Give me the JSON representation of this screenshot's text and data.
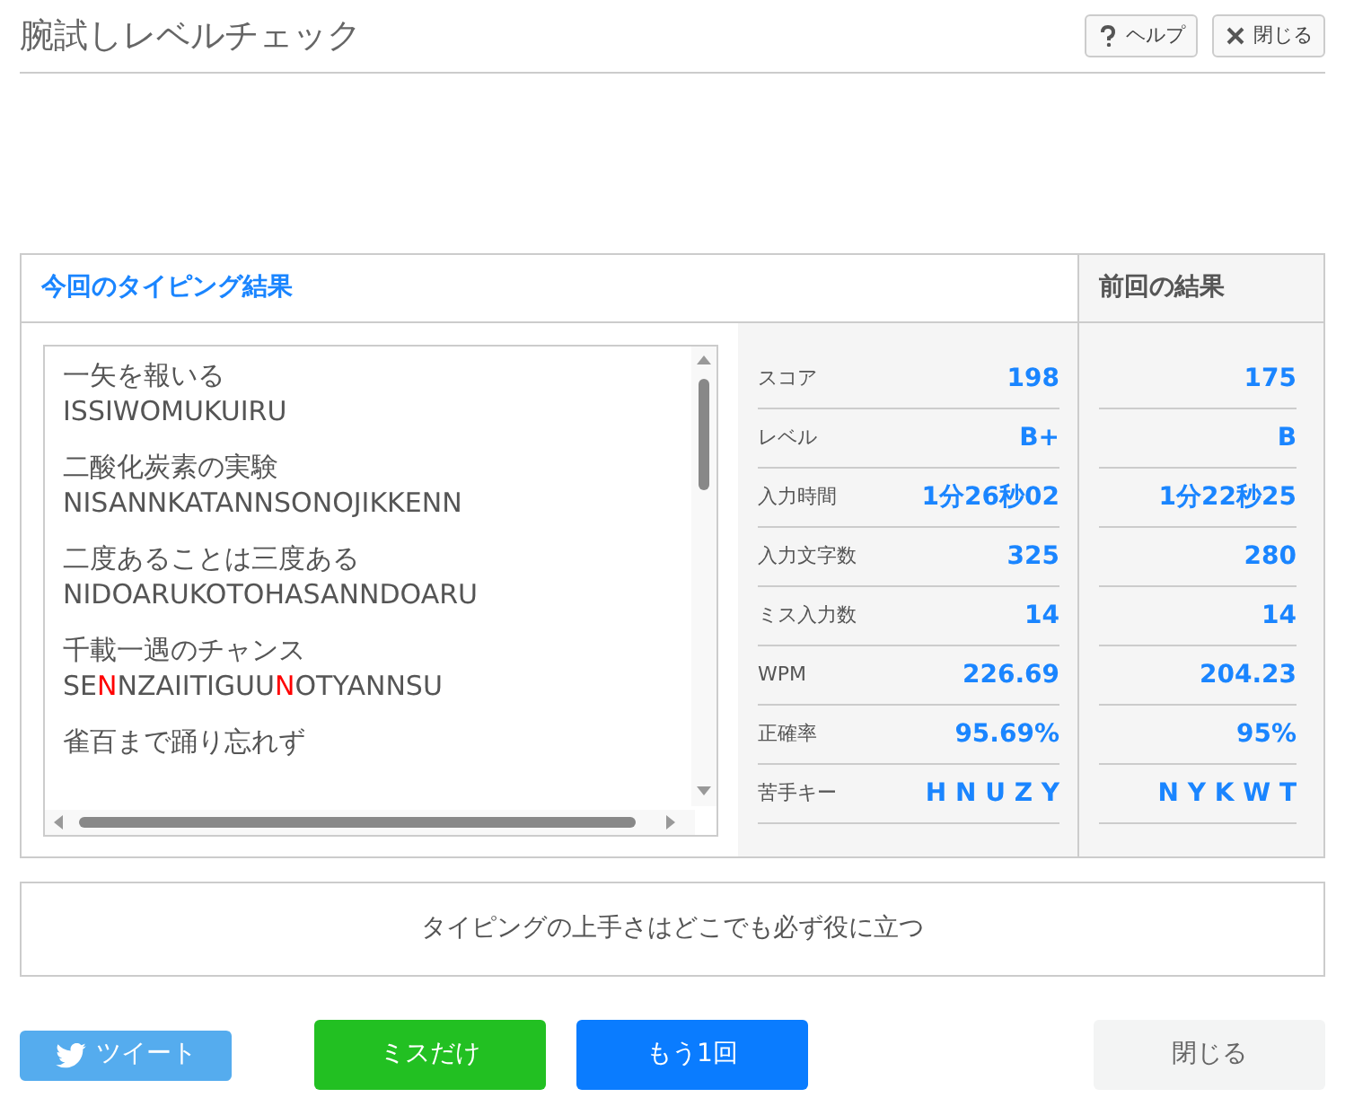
{
  "window": {
    "title": "腕試しレベルチェック"
  },
  "header_buttons": [
    {
      "kind": "help",
      "label": "ヘルプ"
    },
    {
      "kind": "close",
      "label": "閉じる"
    }
  ],
  "current_result": {
    "title": "今回のタイピング結果",
    "words": [
      {
        "text": "一矢を報いる",
        "typed": [
          {
            "text": "ISSIWOMUKUIRU",
            "miss": false
          }
        ]
      },
      {
        "text": "二酸化炭素の実験",
        "typed": [
          {
            "text": "NISANNKATANNSONOJIKKENN",
            "miss": false
          }
        ]
      },
      {
        "text": "二度あることは三度ある",
        "typed": [
          {
            "text": "NIDOARUKOTOHASANNDOARU",
            "miss": false
          }
        ]
      },
      {
        "text": "千載一遇のチャンス",
        "typed": [
          {
            "text": "SE",
            "miss": false
          },
          {
            "text": "N",
            "miss": true
          },
          {
            "text": "NZAIITIGUU",
            "miss": false
          },
          {
            "text": "N",
            "miss": true
          },
          {
            "text": "OTYANNSU",
            "miss": false
          }
        ]
      },
      {
        "text": "雀百まで踊り忘れず"
      }
    ]
  },
  "previous_result": {
    "title": "前回の結果"
  },
  "stats": [
    {
      "label": "スコア",
      "current": "198",
      "previous": "175"
    },
    {
      "label": "レベル",
      "current": "B+",
      "previous": "B"
    },
    {
      "label": "入力時間",
      "current": "1分26秒02",
      "previous": "1分22秒25"
    },
    {
      "label": "入力文字数",
      "current": "325",
      "previous": "280"
    },
    {
      "label": "ミス入力数",
      "current": "14",
      "previous": "14"
    },
    {
      "label": "WPM",
      "current": "226.69",
      "previous": "204.23"
    },
    {
      "label": "正確率",
      "current": "95.69%",
      "previous": "95%"
    },
    {
      "label": "苦手キー",
      "current": "H N U Z Y",
      "previous": "N Y K W T"
    }
  ],
  "message": "タイピングの上手さはどこでも必ず役に立つ",
  "buttons": [
    {
      "kind": "tweet",
      "label": "ツイート"
    },
    {
      "kind": "miss",
      "label": "ミスだけ"
    },
    {
      "kind": "retry",
      "label": "もう1回"
    },
    {
      "kind": "close",
      "label": "閉じる"
    }
  ]
}
